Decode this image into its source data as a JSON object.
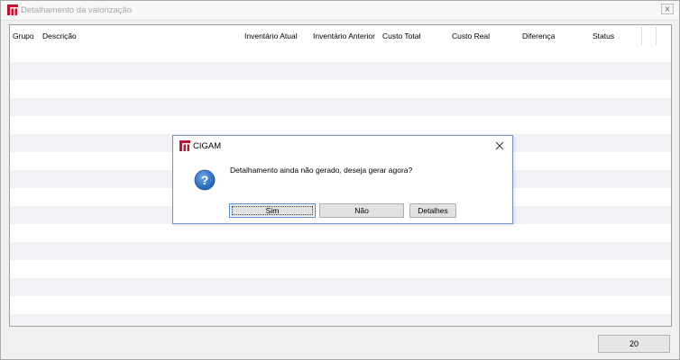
{
  "window": {
    "title": "Detalhamento da valorização",
    "close_icon": "close-icon"
  },
  "grid": {
    "columns": [
      "Grupo",
      "Descrição",
      "Inventário Atual",
      "Inventário Anterior",
      "Custo Total",
      "Custo Real",
      "Diferença",
      "Status"
    ],
    "rows": []
  },
  "footer": {
    "count": "20"
  },
  "dialog": {
    "title": "CIGAM",
    "message": "Detalhamento ainda não gerado, deseja gerar agora?",
    "icon": "question-icon",
    "buttons": {
      "yes": "Sim",
      "no": "Não",
      "details": "Detalhes"
    }
  },
  "colors": {
    "logo_red": "#c8102e",
    "row_alt": "#f0f2f5",
    "dialog_border": "#6f95c9",
    "question_blue": "#1f62b5"
  }
}
